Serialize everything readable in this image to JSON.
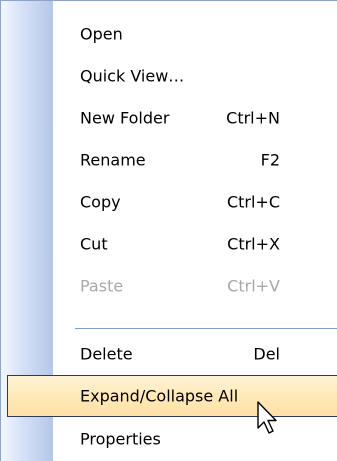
{
  "menu": {
    "items": [
      {
        "label": "Open",
        "shortcut": ""
      },
      {
        "label": "Quick View…",
        "shortcut": ""
      },
      {
        "label": "New Folder",
        "shortcut": "Ctrl+N"
      },
      {
        "label": "Rename",
        "shortcut": "F2"
      },
      {
        "label": "Copy",
        "shortcut": "Ctrl+C"
      },
      {
        "label": "Cut",
        "shortcut": "Ctrl+X"
      },
      {
        "label": "Paste",
        "shortcut": "Ctrl+V",
        "disabled": true
      },
      {
        "label": "Delete",
        "shortcut": "Del"
      },
      {
        "label": "Expand/Collapse All",
        "shortcut": "",
        "highlighted": true
      },
      {
        "label": "Properties",
        "shortcut": ""
      }
    ]
  },
  "colors": {
    "gutter": "#c3d2ee",
    "highlight": "#ffe9b8",
    "highlight_border": "#2d3a56",
    "disabled_text": "#a8a8a8",
    "separator": "#7e9ecf"
  },
  "cursor": {
    "icon": "arrow-pointer-icon"
  }
}
